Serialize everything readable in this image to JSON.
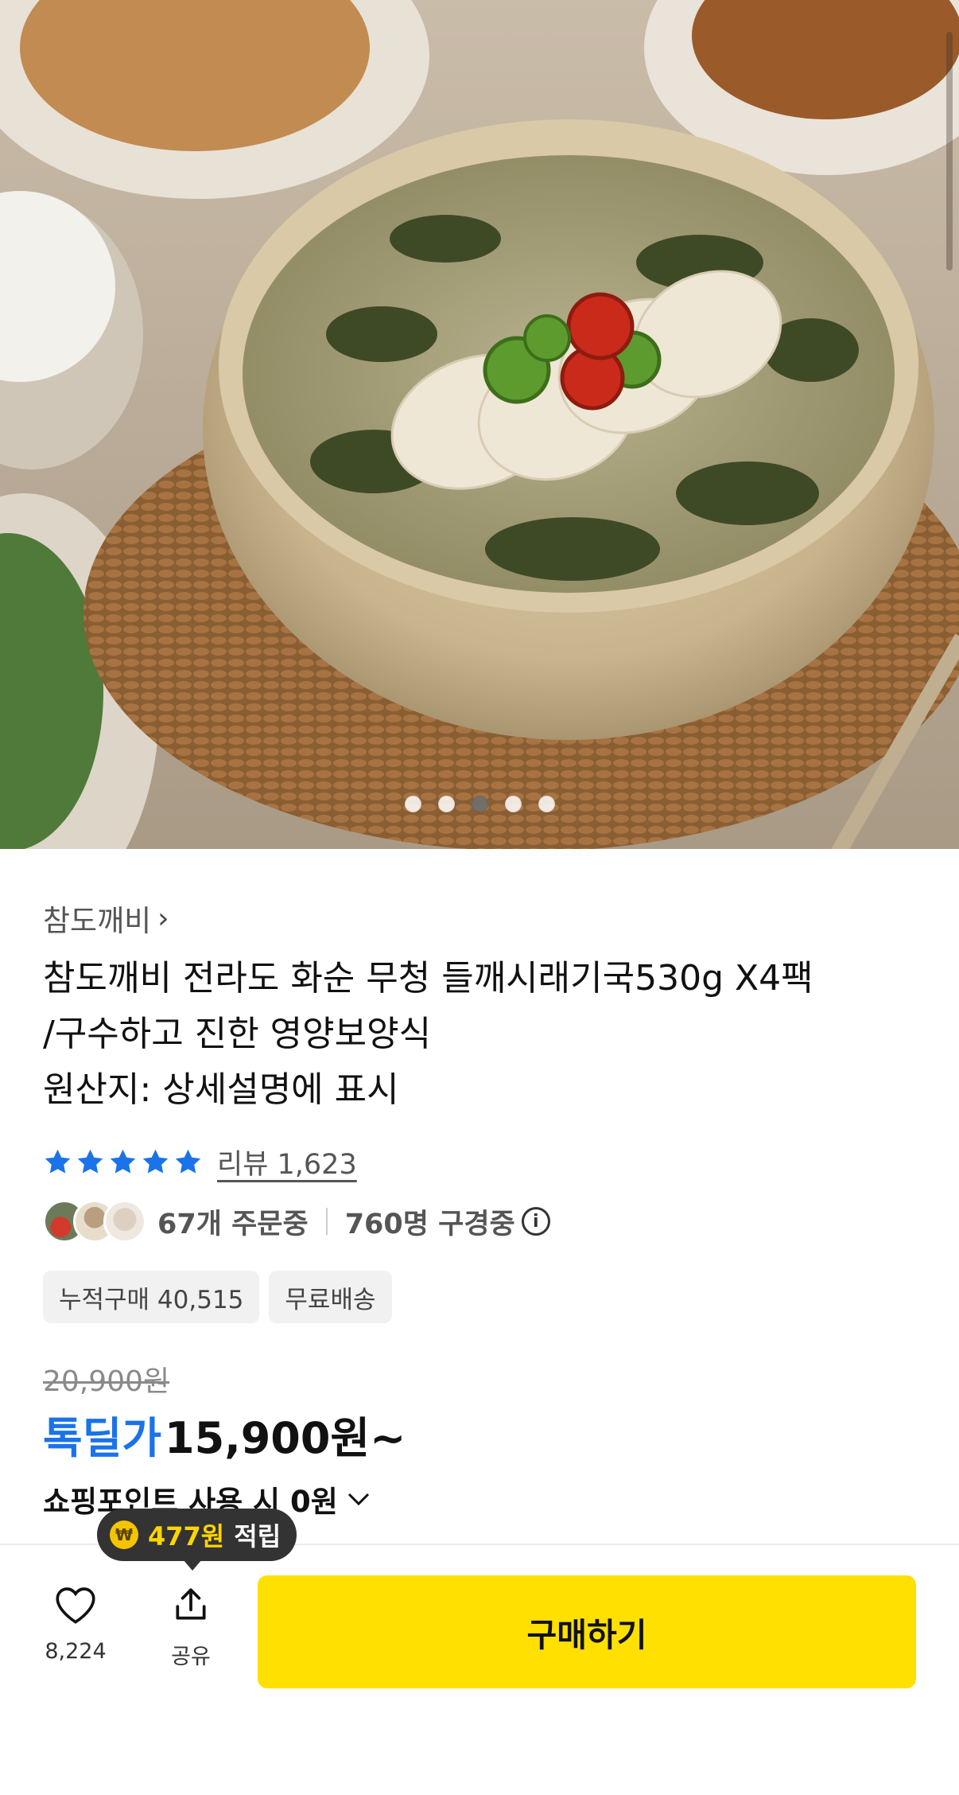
{
  "hero": {
    "image": "product-photo-perilla-soup-bowl",
    "carousel_total": 5,
    "carousel_active_index": 2
  },
  "product": {
    "seller": "참도깨비",
    "title_lines": [
      "참도깨비 전라도 화순 무청 들깨시래기국530g X4팩",
      "/구수하고 진한 영양보양식",
      "원산지: 상세설명에 표시"
    ],
    "rating_stars": 5,
    "review_label": "리뷰 1,623",
    "ordering_text": "67개 주문중",
    "browsing_text": "760명 구경중",
    "badges": [
      "누적구매 40,515",
      "무료배송"
    ],
    "original_price": "20,900원",
    "deal_label": "톡딜가",
    "deal_price": "15,900원~",
    "points_text": "쇼핑포인트 사용 시 0원"
  },
  "bottom_bar": {
    "like_count": "8,224",
    "share_label": "공유",
    "buy_label": "구매하기",
    "tooltip_amount": "477원",
    "tooltip_suffix": "적립"
  },
  "colors": {
    "accent_blue": "#1a73e8",
    "buy_yellow": "#ffe000",
    "star_blue": "#1a73e8"
  }
}
